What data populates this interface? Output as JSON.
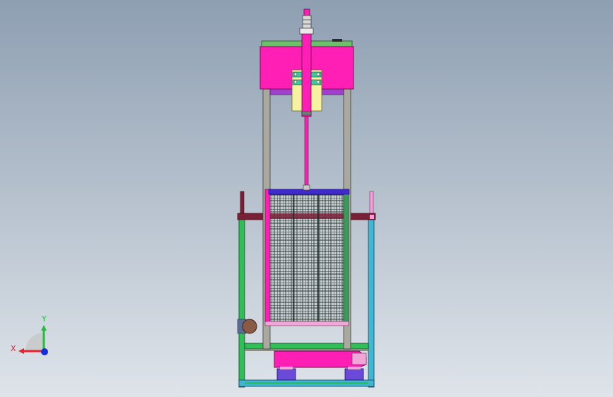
{
  "viewport": {
    "background_top": "#8e9fb2",
    "background_bottom": "#dfe4ea"
  },
  "triad": {
    "x_label": "X",
    "y_label": "Y",
    "x_color": "#e8202a",
    "y_color": "#22c03a",
    "z_color": "#1430d8"
  },
  "model_colors": {
    "magenta": "#ff1fb4",
    "grey_frame": "#a9a9a0",
    "green_frame": "#2fbf57",
    "cyan_frame": "#3fb8d8",
    "maroon_bar": "#7a2036",
    "blue_bar": "#3f2ad0",
    "yellow_bracket": "#f6f2a0",
    "mesh_line": "#2a3a3a",
    "teal_clamp": "#3ec8a0"
  }
}
